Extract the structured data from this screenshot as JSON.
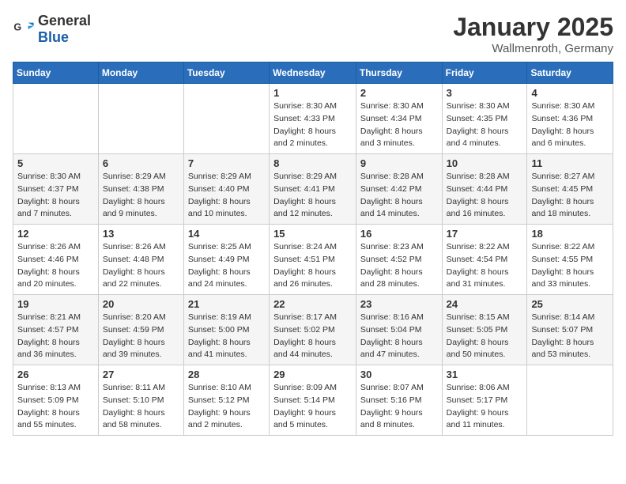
{
  "logo": {
    "general": "General",
    "blue": "Blue"
  },
  "title": "January 2025",
  "location": "Wallmenroth, Germany",
  "weekdays": [
    "Sunday",
    "Monday",
    "Tuesday",
    "Wednesday",
    "Thursday",
    "Friday",
    "Saturday"
  ],
  "weeks": [
    [
      {
        "day": "",
        "info": ""
      },
      {
        "day": "",
        "info": ""
      },
      {
        "day": "",
        "info": ""
      },
      {
        "day": "1",
        "info": "Sunrise: 8:30 AM\nSunset: 4:33 PM\nDaylight: 8 hours and 2 minutes."
      },
      {
        "day": "2",
        "info": "Sunrise: 8:30 AM\nSunset: 4:34 PM\nDaylight: 8 hours and 3 minutes."
      },
      {
        "day": "3",
        "info": "Sunrise: 8:30 AM\nSunset: 4:35 PM\nDaylight: 8 hours and 4 minutes."
      },
      {
        "day": "4",
        "info": "Sunrise: 8:30 AM\nSunset: 4:36 PM\nDaylight: 8 hours and 6 minutes."
      }
    ],
    [
      {
        "day": "5",
        "info": "Sunrise: 8:30 AM\nSunset: 4:37 PM\nDaylight: 8 hours and 7 minutes."
      },
      {
        "day": "6",
        "info": "Sunrise: 8:29 AM\nSunset: 4:38 PM\nDaylight: 8 hours and 9 minutes."
      },
      {
        "day": "7",
        "info": "Sunrise: 8:29 AM\nSunset: 4:40 PM\nDaylight: 8 hours and 10 minutes."
      },
      {
        "day": "8",
        "info": "Sunrise: 8:29 AM\nSunset: 4:41 PM\nDaylight: 8 hours and 12 minutes."
      },
      {
        "day": "9",
        "info": "Sunrise: 8:28 AM\nSunset: 4:42 PM\nDaylight: 8 hours and 14 minutes."
      },
      {
        "day": "10",
        "info": "Sunrise: 8:28 AM\nSunset: 4:44 PM\nDaylight: 8 hours and 16 minutes."
      },
      {
        "day": "11",
        "info": "Sunrise: 8:27 AM\nSunset: 4:45 PM\nDaylight: 8 hours and 18 minutes."
      }
    ],
    [
      {
        "day": "12",
        "info": "Sunrise: 8:26 AM\nSunset: 4:46 PM\nDaylight: 8 hours and 20 minutes."
      },
      {
        "day": "13",
        "info": "Sunrise: 8:26 AM\nSunset: 4:48 PM\nDaylight: 8 hours and 22 minutes."
      },
      {
        "day": "14",
        "info": "Sunrise: 8:25 AM\nSunset: 4:49 PM\nDaylight: 8 hours and 24 minutes."
      },
      {
        "day": "15",
        "info": "Sunrise: 8:24 AM\nSunset: 4:51 PM\nDaylight: 8 hours and 26 minutes."
      },
      {
        "day": "16",
        "info": "Sunrise: 8:23 AM\nSunset: 4:52 PM\nDaylight: 8 hours and 28 minutes."
      },
      {
        "day": "17",
        "info": "Sunrise: 8:22 AM\nSunset: 4:54 PM\nDaylight: 8 hours and 31 minutes."
      },
      {
        "day": "18",
        "info": "Sunrise: 8:22 AM\nSunset: 4:55 PM\nDaylight: 8 hours and 33 minutes."
      }
    ],
    [
      {
        "day": "19",
        "info": "Sunrise: 8:21 AM\nSunset: 4:57 PM\nDaylight: 8 hours and 36 minutes."
      },
      {
        "day": "20",
        "info": "Sunrise: 8:20 AM\nSunset: 4:59 PM\nDaylight: 8 hours and 39 minutes."
      },
      {
        "day": "21",
        "info": "Sunrise: 8:19 AM\nSunset: 5:00 PM\nDaylight: 8 hours and 41 minutes."
      },
      {
        "day": "22",
        "info": "Sunrise: 8:17 AM\nSunset: 5:02 PM\nDaylight: 8 hours and 44 minutes."
      },
      {
        "day": "23",
        "info": "Sunrise: 8:16 AM\nSunset: 5:04 PM\nDaylight: 8 hours and 47 minutes."
      },
      {
        "day": "24",
        "info": "Sunrise: 8:15 AM\nSunset: 5:05 PM\nDaylight: 8 hours and 50 minutes."
      },
      {
        "day": "25",
        "info": "Sunrise: 8:14 AM\nSunset: 5:07 PM\nDaylight: 8 hours and 53 minutes."
      }
    ],
    [
      {
        "day": "26",
        "info": "Sunrise: 8:13 AM\nSunset: 5:09 PM\nDaylight: 8 hours and 55 minutes."
      },
      {
        "day": "27",
        "info": "Sunrise: 8:11 AM\nSunset: 5:10 PM\nDaylight: 8 hours and 58 minutes."
      },
      {
        "day": "28",
        "info": "Sunrise: 8:10 AM\nSunset: 5:12 PM\nDaylight: 9 hours and 2 minutes."
      },
      {
        "day": "29",
        "info": "Sunrise: 8:09 AM\nSunset: 5:14 PM\nDaylight: 9 hours and 5 minutes."
      },
      {
        "day": "30",
        "info": "Sunrise: 8:07 AM\nSunset: 5:16 PM\nDaylight: 9 hours and 8 minutes."
      },
      {
        "day": "31",
        "info": "Sunrise: 8:06 AM\nSunset: 5:17 PM\nDaylight: 9 hours and 11 minutes."
      },
      {
        "day": "",
        "info": ""
      }
    ]
  ]
}
